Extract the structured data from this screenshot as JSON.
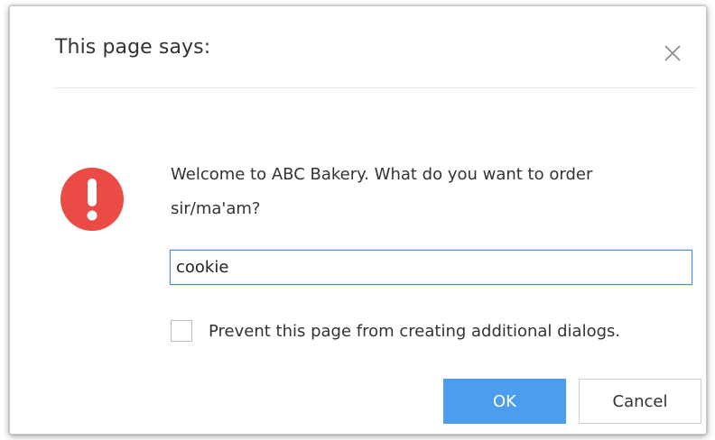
{
  "dialog": {
    "title": "This page says:",
    "message": "Welcome to ABC Bakery. What do you want to order sir/ma'am?",
    "input_value": "cookie",
    "checkbox_label": "Prevent this page from creating additional dialogs.",
    "checkbox_checked": false,
    "ok_label": "OK",
    "cancel_label": "Cancel",
    "icon": "alert-icon",
    "close_icon": "close-icon"
  },
  "colors": {
    "alert_red": "#ea4b45",
    "primary_button": "#4c9df0",
    "input_focus_border": "#4a90e2"
  }
}
